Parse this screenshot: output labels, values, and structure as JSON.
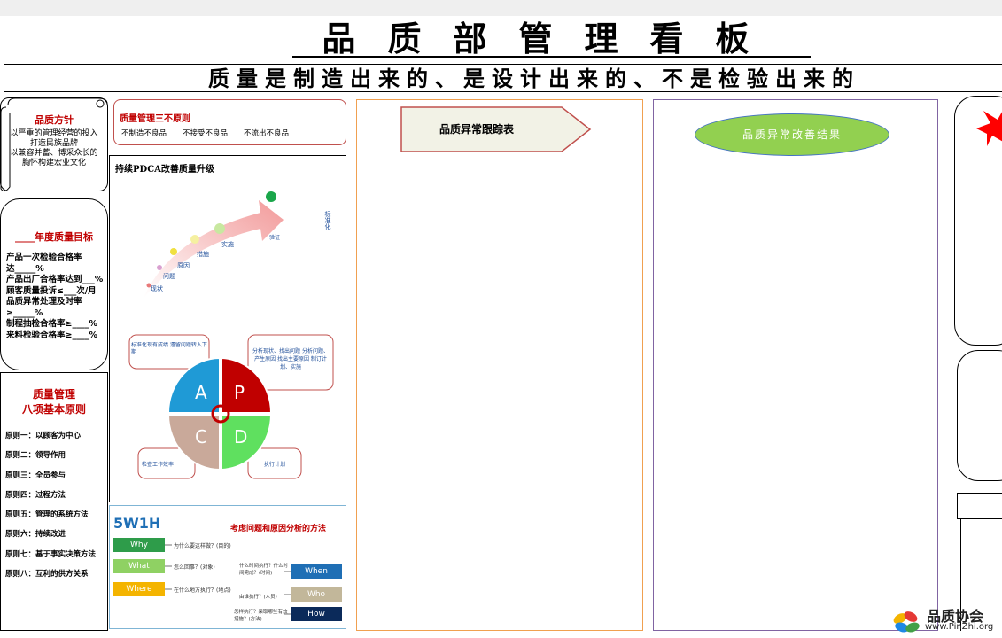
{
  "title": "品质部管理看板",
  "slogan": "质量是制造出来的、是设计出来的、不是检验出来的",
  "policy": {
    "title": "品质方针",
    "lines": [
      "以严重的管理经营的投入",
      "打造民族品牌",
      "以兼容并蓄、博采众长的",
      "胸怀构建宏业文化"
    ]
  },
  "annual_goal": {
    "title": "____年度质量目标",
    "lines": [
      "产品一次检验合格率",
      "达_____%",
      "产品出厂合格率达到___%",
      "顾客质量投诉≤___次/月",
      "品质异常处理及时率",
      "≥_____%",
      "制程抽检合格率≥____%",
      "来料检验合格率≥____%"
    ]
  },
  "eight_principles": {
    "title_line1": "质量管理",
    "title_line2": "八项基本原则",
    "items": [
      "原则一：以顾客为中心",
      "原则二：领导作用",
      "原则三：全员参与",
      "原则四：过程方法",
      "原则五：管理的系统方法",
      "原则六：持续改进",
      "原则七：基于事实决策方法",
      "原则八：互利的供方关系"
    ]
  },
  "three_no": {
    "title": "质量管理三不原则",
    "items": [
      "不制造不良品",
      "不接受不良品",
      "不流出不良品"
    ]
  },
  "pdca": {
    "title": "持续PDCA改善质量升级",
    "steps": [
      "现状",
      "问题",
      "原因",
      "措施",
      "实施",
      "验证"
    ],
    "standardize": "标准化",
    "box_a": "标准化现有成绩 遗留问题转入下期",
    "box_p": "分析现状、找出问题 分析问题、产生原因 找出主要原因 制订计划、实施",
    "box_c": "检查工作效率",
    "box_d": "执行计划",
    "quadrants": [
      "A",
      "P",
      "C",
      "D"
    ]
  },
  "fivew": {
    "title": "5W1H",
    "subtitle": "考虑问题和原因分析的方法",
    "left": [
      {
        "tag": "Why",
        "text": "为什么要这样做？(目的)",
        "color": "#2e9c4a"
      },
      {
        "tag": "What",
        "text": "怎么回事？(对象)",
        "color": "#8fd163"
      },
      {
        "tag": "Where",
        "text": "在什么地方执行？(地点)",
        "color": "#f4b400"
      }
    ],
    "right": [
      {
        "tag": "When",
        "text": "什么时间执行？什么时间完成？(时间)",
        "color": "#1f6fb5"
      },
      {
        "tag": "Who",
        "text": "由谁执行？(人员)",
        "color": "#c2b79a"
      },
      {
        "tag": "How",
        "text": "怎样执行？采取哪些有效措施？(方法)",
        "color": "#0b2a5a"
      }
    ]
  },
  "tracking": {
    "label": "品质异常跟踪表"
  },
  "results": {
    "label": "品质异常改善结果"
  },
  "watermark": {
    "name": "品质协会",
    "url": "www.PinZhi.org"
  },
  "colors": {
    "accent_red": "#c00000",
    "green": "#92d050",
    "arrow_fill": "#f2f2e6"
  }
}
